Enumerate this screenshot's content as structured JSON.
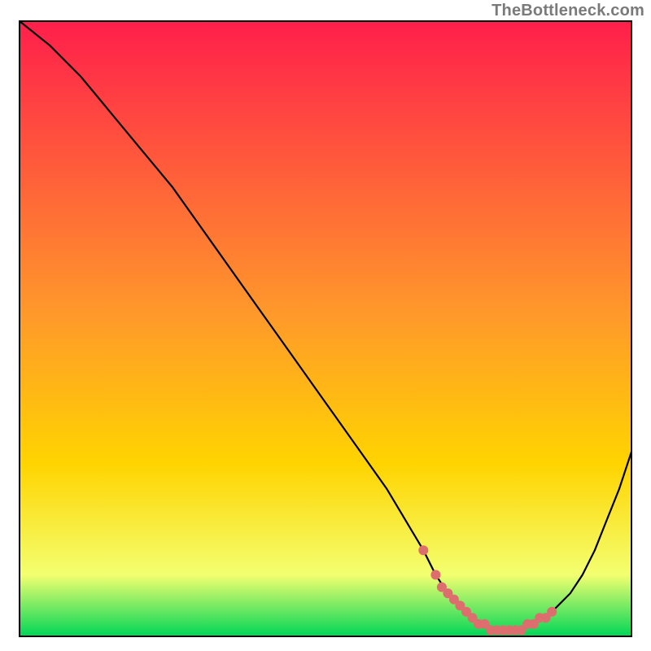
{
  "attribution": "TheBottleneck.com",
  "colors": {
    "grad_top": "#ff1f4b",
    "grad_mid": "#ffd400",
    "grad_bottom": "#00d657",
    "border": "#000000",
    "curve": "#000000",
    "marker": "#de6d6e"
  },
  "chart_data": {
    "type": "line",
    "title": "",
    "xlabel": "",
    "ylabel": "",
    "xlim": [
      0,
      100
    ],
    "ylim": [
      0,
      100
    ],
    "series": [
      {
        "name": "bottleneck-curve",
        "x": [
          0,
          5,
          10,
          15,
          20,
          25,
          30,
          35,
          40,
          45,
          50,
          55,
          60,
          63,
          66,
          68,
          70,
          72,
          74,
          76,
          78,
          80,
          82,
          84,
          86,
          88,
          90,
          92,
          94,
          96,
          98,
          100
        ],
        "y": [
          100,
          96,
          91,
          85,
          79,
          73,
          66,
          59,
          52,
          45,
          38,
          31,
          24,
          19,
          14,
          10,
          7,
          5,
          3,
          2,
          1,
          1,
          1,
          2,
          3,
          5,
          7,
          10,
          14,
          19,
          24,
          30
        ]
      }
    ],
    "markers": {
      "name": "optimal-range",
      "x": [
        66,
        68,
        69,
        70,
        71,
        72,
        73,
        74,
        75,
        76,
        77,
        78,
        79,
        80,
        81,
        82,
        83,
        84,
        85,
        86,
        87
      ],
      "y": [
        14,
        10,
        8,
        7,
        6,
        5,
        4,
        3,
        2,
        2,
        1,
        1,
        1,
        1,
        1,
        1,
        2,
        2,
        3,
        3,
        4
      ]
    }
  }
}
